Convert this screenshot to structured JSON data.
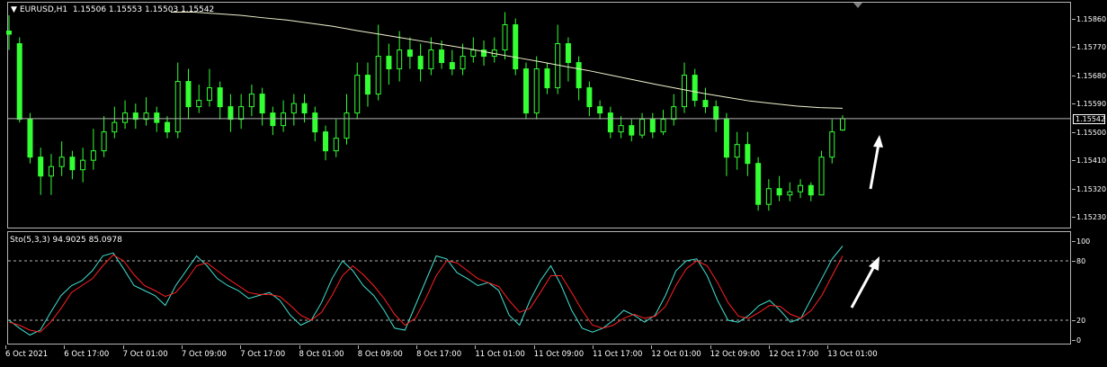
{
  "window": {
    "symbol_line": "EURUSD,H1  1.15506 1.15553 1.15503 1.15542",
    "menu_glyph": "▼"
  },
  "price_axis": {
    "labels": [
      "1.15860",
      "1.15770",
      "1.15680",
      "1.15590",
      "1.15500",
      "1.15410",
      "1.15320",
      "1.15230"
    ],
    "values": [
      1.1586,
      1.1577,
      1.1568,
      1.1559,
      1.155,
      1.1541,
      1.1532,
      1.1523
    ],
    "current_price_label": "1.15542",
    "current_price": 1.15542
  },
  "oscillator": {
    "header": "Sto(5,3,3) 94.9025 85.0978",
    "axis_labels": [
      "100",
      "80",
      "20",
      "0"
    ],
    "axis_values": [
      100,
      80,
      20,
      0
    ],
    "levels": [
      80,
      20
    ]
  },
  "time_axis": {
    "labels": [
      "6 Oct 2021",
      "6 Oct 17:00",
      "7 Oct 01:00",
      "7 Oct 09:00",
      "7 Oct 17:00",
      "8 Oct 01:00",
      "8 Oct 09:00",
      "8 Oct 17:00",
      "11 Oct 01:00",
      "11 Oct 09:00",
      "11 Oct 17:00",
      "12 Oct 01:00",
      "12 Oct 09:00",
      "12 Oct 17:00",
      "13 Oct 01:00"
    ]
  },
  "colors": {
    "background": "#000000",
    "candle": "#33ff33",
    "moving_average": "#f2f2d0",
    "main_line": "#40e0d0",
    "signal_line": "#ff2020",
    "grid": "#b4b4b4",
    "arrow": "#ffffff"
  },
  "chart_data": [
    {
      "type": "candlestick",
      "title": "EURUSD,H1",
      "ylim": [
        1.152,
        1.159
      ],
      "candles": [
        [
          1.1582,
          1.1581,
          1.1587,
          1.1576
        ],
        [
          1.1578,
          1.1554,
          1.158,
          1.1553
        ],
        [
          1.1554,
          1.1542,
          1.1556,
          1.154
        ],
        [
          1.1542,
          1.1536,
          1.1545,
          1.153
        ],
        [
          1.1536,
          1.1539,
          1.1543,
          1.153
        ],
        [
          1.1539,
          1.1542,
          1.1547,
          1.1536
        ],
        [
          1.1542,
          1.1538,
          1.1544,
          1.1535
        ],
        [
          1.1538,
          1.1541,
          1.1545,
          1.1534
        ],
        [
          1.1541,
          1.1544,
          1.1551,
          1.1538
        ],
        [
          1.1544,
          1.155,
          1.1555,
          1.1542
        ],
        [
          1.155,
          1.1553,
          1.1558,
          1.1548
        ],
        [
          1.1553,
          1.1556,
          1.156,
          1.1551
        ],
        [
          1.1556,
          1.1554,
          1.1559,
          1.1551
        ],
        [
          1.1554,
          1.1556,
          1.1561,
          1.1552
        ],
        [
          1.1556,
          1.1553,
          1.1558,
          1.155
        ],
        [
          1.1553,
          1.155,
          1.1555,
          1.1548
        ],
        [
          1.155,
          1.1566,
          1.1572,
          1.1548
        ],
        [
          1.1566,
          1.1558,
          1.157,
          1.1554
        ],
        [
          1.1558,
          1.156,
          1.1565,
          1.1556
        ],
        [
          1.156,
          1.1564,
          1.157,
          1.1558
        ],
        [
          1.1564,
          1.1558,
          1.1566,
          1.1554
        ],
        [
          1.1558,
          1.1554,
          1.1562,
          1.155
        ],
        [
          1.1554,
          1.1558,
          1.1562,
          1.1551
        ],
        [
          1.1558,
          1.1562,
          1.1565,
          1.1555
        ],
        [
          1.1562,
          1.1556,
          1.1564,
          1.1552
        ],
        [
          1.1556,
          1.1552,
          1.1558,
          1.1549
        ],
        [
          1.1552,
          1.1556,
          1.156,
          1.155
        ],
        [
          1.1556,
          1.1559,
          1.1562,
          1.1552
        ],
        [
          1.1559,
          1.1556,
          1.1562,
          1.1553
        ],
        [
          1.1556,
          1.155,
          1.1558,
          1.1547
        ],
        [
          1.155,
          1.1544,
          1.1552,
          1.1541
        ],
        [
          1.1544,
          1.1548,
          1.1554,
          1.1542
        ],
        [
          1.1548,
          1.1556,
          1.1562,
          1.1546
        ],
        [
          1.1556,
          1.1568,
          1.1572,
          1.1554
        ],
        [
          1.1568,
          1.1562,
          1.1572,
          1.1558
        ],
        [
          1.1562,
          1.1574,
          1.1584,
          1.156
        ],
        [
          1.1574,
          1.157,
          1.1578,
          1.1565
        ],
        [
          1.157,
          1.1576,
          1.1582,
          1.1566
        ],
        [
          1.1576,
          1.1574,
          1.158,
          1.157
        ],
        [
          1.1574,
          1.157,
          1.1578,
          1.1566
        ],
        [
          1.157,
          1.1576,
          1.158,
          1.1568
        ],
        [
          1.1576,
          1.1572,
          1.1579,
          1.157
        ],
        [
          1.1572,
          1.157,
          1.1576,
          1.1568
        ],
        [
          1.157,
          1.1574,
          1.1578,
          1.1568
        ],
        [
          1.1574,
          1.1576,
          1.158,
          1.1572
        ],
        [
          1.1576,
          1.1574,
          1.1579,
          1.1571
        ],
        [
          1.1574,
          1.1576,
          1.158,
          1.1572
        ],
        [
          1.1576,
          1.1584,
          1.1588,
          1.1573
        ],
        [
          1.1584,
          1.157,
          1.1586,
          1.1568
        ],
        [
          1.157,
          1.1556,
          1.1572,
          1.1554
        ],
        [
          1.1556,
          1.157,
          1.1574,
          1.1554
        ],
        [
          1.157,
          1.1564,
          1.1572,
          1.1562
        ],
        [
          1.1564,
          1.1578,
          1.1584,
          1.1562
        ],
        [
          1.1578,
          1.1572,
          1.158,
          1.1566
        ],
        [
          1.1572,
          1.1564,
          1.1574,
          1.156
        ],
        [
          1.1564,
          1.1558,
          1.1566,
          1.1555
        ],
        [
          1.1558,
          1.1556,
          1.156,
          1.1554
        ],
        [
          1.1556,
          1.155,
          1.1558,
          1.1548
        ],
        [
          1.155,
          1.1552,
          1.1555,
          1.1548
        ],
        [
          1.1552,
          1.1549,
          1.1554,
          1.1547
        ],
        [
          1.1549,
          1.1554,
          1.1556,
          1.1548
        ],
        [
          1.1554,
          1.155,
          1.1556,
          1.1548
        ],
        [
          1.155,
          1.1554,
          1.1557,
          1.1549
        ],
        [
          1.1554,
          1.1558,
          1.1562,
          1.1552
        ],
        [
          1.1558,
          1.1568,
          1.1572,
          1.1556
        ],
        [
          1.1568,
          1.156,
          1.157,
          1.1558
        ],
        [
          1.156,
          1.1558,
          1.1564,
          1.1556
        ],
        [
          1.1558,
          1.1554,
          1.156,
          1.155
        ],
        [
          1.1554,
          1.1542,
          1.1556,
          1.1536
        ],
        [
          1.1542,
          1.1546,
          1.155,
          1.1538
        ],
        [
          1.1546,
          1.154,
          1.155,
          1.1536
        ],
        [
          1.154,
          1.1527,
          1.1542,
          1.1525
        ],
        [
          1.1527,
          1.1532,
          1.1535,
          1.1525
        ],
        [
          1.1532,
          1.153,
          1.1536,
          1.1528
        ],
        [
          1.153,
          1.1531,
          1.1534,
          1.1528
        ],
        [
          1.1531,
          1.1533,
          1.1535,
          1.1529
        ],
        [
          1.1533,
          1.153,
          1.1534,
          1.1528
        ],
        [
          1.153,
          1.1542,
          1.1544,
          1.153
        ],
        [
          1.1542,
          1.155,
          1.1554,
          1.154
        ],
        [
          1.15506,
          1.15542,
          1.15553,
          1.15503
        ]
      ],
      "moving_average": [
        1.1588,
        1.1588,
        1.15875,
        1.1587,
        1.15862,
        1.15855,
        1.15845,
        1.15835,
        1.15822,
        1.1581,
        1.15798,
        1.15786,
        1.15774,
        1.15762,
        1.15748,
        1.15735,
        1.15722,
        1.15708,
        1.15695,
        1.1568,
        1.15665,
        1.1565,
        1.15636,
        1.15622,
        1.1561,
        1.15598,
        1.1559,
        1.15582,
        1.15577,
        1.15575
      ]
    },
    {
      "type": "line",
      "title": "Sto(5,3,3)",
      "ylim": [
        0,
        100
      ],
      "series": [
        {
          "name": "main",
          "values": [
            20,
            12,
            5,
            10,
            28,
            45,
            55,
            60,
            70,
            85,
            88,
            72,
            55,
            50,
            45,
            35,
            55,
            70,
            85,
            75,
            62,
            55,
            50,
            42,
            45,
            48,
            40,
            25,
            15,
            20,
            38,
            62,
            80,
            70,
            55,
            45,
            30,
            12,
            10,
            35,
            60,
            85,
            82,
            68,
            62,
            55,
            58,
            50,
            25,
            15,
            40,
            60,
            75,
            55,
            30,
            12,
            8,
            12,
            20,
            30,
            25,
            18,
            25,
            45,
            70,
            80,
            82,
            65,
            40,
            20,
            18,
            25,
            35,
            40,
            30,
            18,
            22,
            42,
            62,
            82,
            95
          ]
        },
        {
          "name": "signal",
          "values": [
            18,
            15,
            10,
            8,
            18,
            32,
            48,
            55,
            62,
            75,
            86,
            80,
            66,
            55,
            50,
            44,
            48,
            60,
            75,
            78,
            70,
            62,
            55,
            48,
            46,
            46,
            44,
            35,
            25,
            20,
            28,
            45,
            65,
            75,
            66,
            55,
            42,
            26,
            15,
            22,
            42,
            65,
            80,
            78,
            70,
            62,
            58,
            54,
            40,
            28,
            32,
            48,
            65,
            65,
            48,
            30,
            15,
            12,
            15,
            22,
            26,
            22,
            24,
            34,
            55,
            72,
            80,
            75,
            58,
            38,
            24,
            22,
            28,
            35,
            34,
            26,
            22,
            30,
            45,
            65,
            85
          ]
        }
      ]
    }
  ]
}
